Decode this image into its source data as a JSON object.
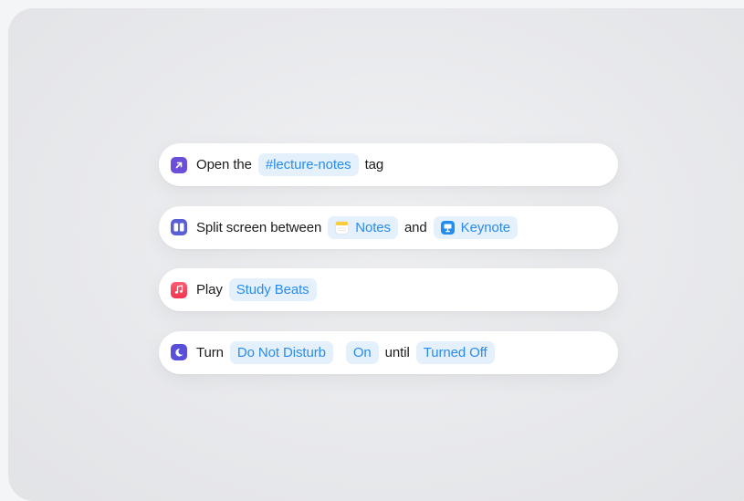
{
  "actions": [
    {
      "icon": "arrow-up-right-icon",
      "icon_color": "#6b4fd8",
      "parts": [
        {
          "type": "text",
          "text": "Open the"
        },
        {
          "type": "pill",
          "text": "#lecture-notes"
        },
        {
          "type": "text",
          "text": "tag"
        }
      ]
    },
    {
      "icon": "split-screen-icon",
      "icon_color": "#5a5fd6",
      "parts": [
        {
          "type": "text",
          "text": "Split screen between"
        },
        {
          "type": "pill",
          "text": "Notes",
          "icon": "notes-app-icon"
        },
        {
          "type": "text",
          "text": "and"
        },
        {
          "type": "pill",
          "text": "Keynote",
          "icon": "keynote-app-icon"
        }
      ]
    },
    {
      "icon": "music-note-icon",
      "icon_color": "#f0354f",
      "parts": [
        {
          "type": "text",
          "text": "Play"
        },
        {
          "type": "pill",
          "text": "Study Beats"
        }
      ]
    },
    {
      "icon": "moon-icon",
      "icon_color": "#5a4fd8",
      "parts": [
        {
          "type": "text",
          "text": "Turn"
        },
        {
          "type": "pill",
          "text": "Do Not Disturb"
        },
        {
          "type": "pill",
          "text": "On"
        },
        {
          "type": "text",
          "text": "until"
        },
        {
          "type": "pill",
          "text": "Turned Off"
        }
      ]
    }
  ]
}
